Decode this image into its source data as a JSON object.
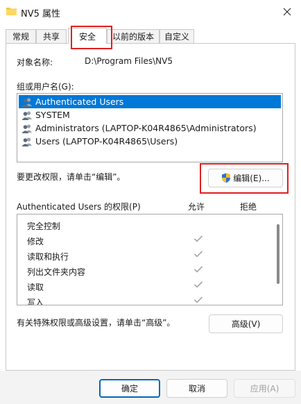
{
  "window": {
    "title": "NV5 属性",
    "close_icon": "close-icon",
    "folder_icon": "folder-icon"
  },
  "tabs": [
    {
      "label": "常规"
    },
    {
      "label": "共享"
    },
    {
      "label": "安全",
      "active": true
    },
    {
      "label": "以前的版本"
    },
    {
      "label": "自定义"
    }
  ],
  "object": {
    "label": "对象名称:",
    "value": "D:\\Program Files\\NV5"
  },
  "groups": {
    "label": "组或用户名(G):",
    "items": [
      {
        "label": "Authenticated Users",
        "selected": true
      },
      {
        "label": "SYSTEM"
      },
      {
        "label": "Administrators (LAPTOP-K04R4865\\Administrators)"
      },
      {
        "label": "Users (LAPTOP-K04R4865\\Users)"
      }
    ]
  },
  "edit": {
    "hint": "要更改权限，请单击“编辑”。",
    "button_label": "编辑(E)..."
  },
  "permissions": {
    "header": "Authenticated Users 的权限(P)",
    "allow_header": "允许",
    "deny_header": "拒绝",
    "rows": [
      {
        "name": "完全控制",
        "allow": false,
        "deny": false
      },
      {
        "name": "修改",
        "allow": true,
        "deny": false
      },
      {
        "name": "读取和执行",
        "allow": true,
        "deny": false
      },
      {
        "name": "列出文件夹内容",
        "allow": true,
        "deny": false
      },
      {
        "name": "读取",
        "allow": true,
        "deny": false
      },
      {
        "name": "写入",
        "allow": true,
        "deny": false
      }
    ]
  },
  "advanced": {
    "hint": "有关特殊权限或高级设置，请单击“高级”。",
    "button_label": "高级(V)"
  },
  "footer": {
    "ok": "确定",
    "cancel": "取消",
    "apply": "应用(A)"
  },
  "colors": {
    "selection": "#0078d7",
    "highlight": "#e01e1e",
    "primary_border": "#0067c0"
  }
}
